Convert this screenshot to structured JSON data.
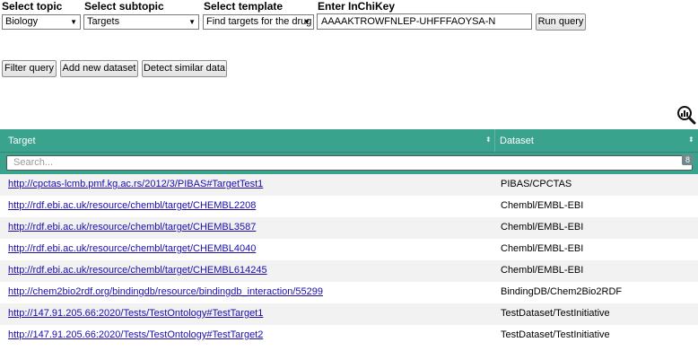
{
  "form": {
    "topic_label": "Select topic",
    "topic_value": "Biology",
    "subtopic_label": "Select subtopic",
    "subtopic_value": "Targets",
    "template_label": "Select template",
    "template_value": "Find targets for the drug",
    "inchikey_label": "Enter InChiKey",
    "inchikey_value": "AAAAKTROWFNLEP-UHFFFAOYSA-N",
    "run_label": "Run query"
  },
  "actions": {
    "filter_label": "Filter query",
    "add_label": "Add new dataset",
    "detect_label": "Detect similar data"
  },
  "table": {
    "col_target": "Target",
    "col_dataset": "Dataset",
    "search_placeholder": "Search...",
    "count": "8",
    "rows": [
      {
        "target": "http://cpctas-lcmb.pmf.kg.ac.rs/2012/3/PIBAS#TargetTest1",
        "dataset": "PIBAS/CPCTAS"
      },
      {
        "target": "http://rdf.ebi.ac.uk/resource/chembl/target/CHEMBL2208",
        "dataset": "Chembl/EMBL-EBI"
      },
      {
        "target": "http://rdf.ebi.ac.uk/resource/chembl/target/CHEMBL3587",
        "dataset": "Chembl/EMBL-EBI"
      },
      {
        "target": "http://rdf.ebi.ac.uk/resource/chembl/target/CHEMBL4040",
        "dataset": "Chembl/EMBL-EBI"
      },
      {
        "target": "http://rdf.ebi.ac.uk/resource/chembl/target/CHEMBL614245",
        "dataset": "Chembl/EMBL-EBI"
      },
      {
        "target": "http://chem2bio2rdf.org/bindingdb/resource/bindingdb_interaction/55299",
        "dataset": "BindingDB/Chem2Bio2RDF"
      },
      {
        "target": "http://147.91.205.66:2020/Tests/TestOntology#TestTarget1",
        "dataset": "TestDataset/TestInitiative"
      },
      {
        "target": "http://147.91.205.66:2020/Tests/TestOntology#TestTarget2",
        "dataset": "TestDataset/TestInitiative"
      }
    ]
  },
  "colors": {
    "header": "#3aa38e",
    "link": "#1a0dab"
  },
  "icons": {
    "analyze": "magnifier-chart-icon",
    "dropdown": "chevron-down-icon",
    "sort": "sort-icon"
  }
}
